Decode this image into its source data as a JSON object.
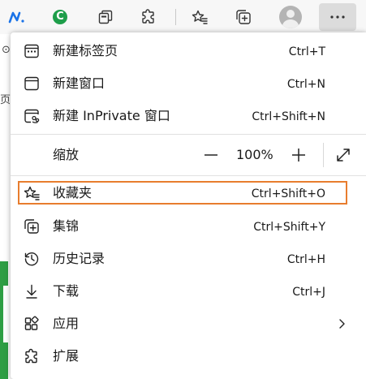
{
  "menu": {
    "items": [
      {
        "label": "新建标签页",
        "shortcut": "Ctrl+T",
        "icon": "new-tab-icon"
      },
      {
        "label": "新建窗口",
        "shortcut": "Ctrl+N",
        "icon": "new-window-icon"
      },
      {
        "label": "新建 InPrivate 窗口",
        "shortcut": "Ctrl+Shift+N",
        "icon": "inprivate-window-icon"
      },
      {
        "label": "收藏夹",
        "shortcut": "Ctrl+Shift+O",
        "icon": "favorites-icon",
        "highlighted": true
      },
      {
        "label": "集锦",
        "shortcut": "Ctrl+Shift+Y",
        "icon": "collections-icon"
      },
      {
        "label": "历史记录",
        "shortcut": "Ctrl+H",
        "icon": "history-icon"
      },
      {
        "label": "下载",
        "shortcut": "Ctrl+J",
        "icon": "download-icon"
      },
      {
        "label": "应用",
        "shortcut": "",
        "icon": "apps-icon",
        "has_submenu": true
      },
      {
        "label": "扩展",
        "shortcut": "",
        "icon": "extensions-icon"
      }
    ],
    "zoom": {
      "label": "缩放",
      "value": "100%",
      "minus": "—",
      "plus": "+"
    }
  },
  "toolbar": {
    "icons": [
      "extension-n-icon",
      "extension-c-icon",
      "tab-actions-icon",
      "extensions-icon",
      "favorites-icon",
      "collections-icon",
      "profile-avatar",
      "more-icon"
    ],
    "ext_c_letter": "C",
    "ext_n_letter": "N"
  },
  "background_page": {
    "fragment_a": "⊙",
    "fragment_b": "页"
  },
  "colors": {
    "highlight_border": "#e87d2e",
    "accent_green": "#2e9e44",
    "ext_n_blue": "#1a73e8"
  }
}
